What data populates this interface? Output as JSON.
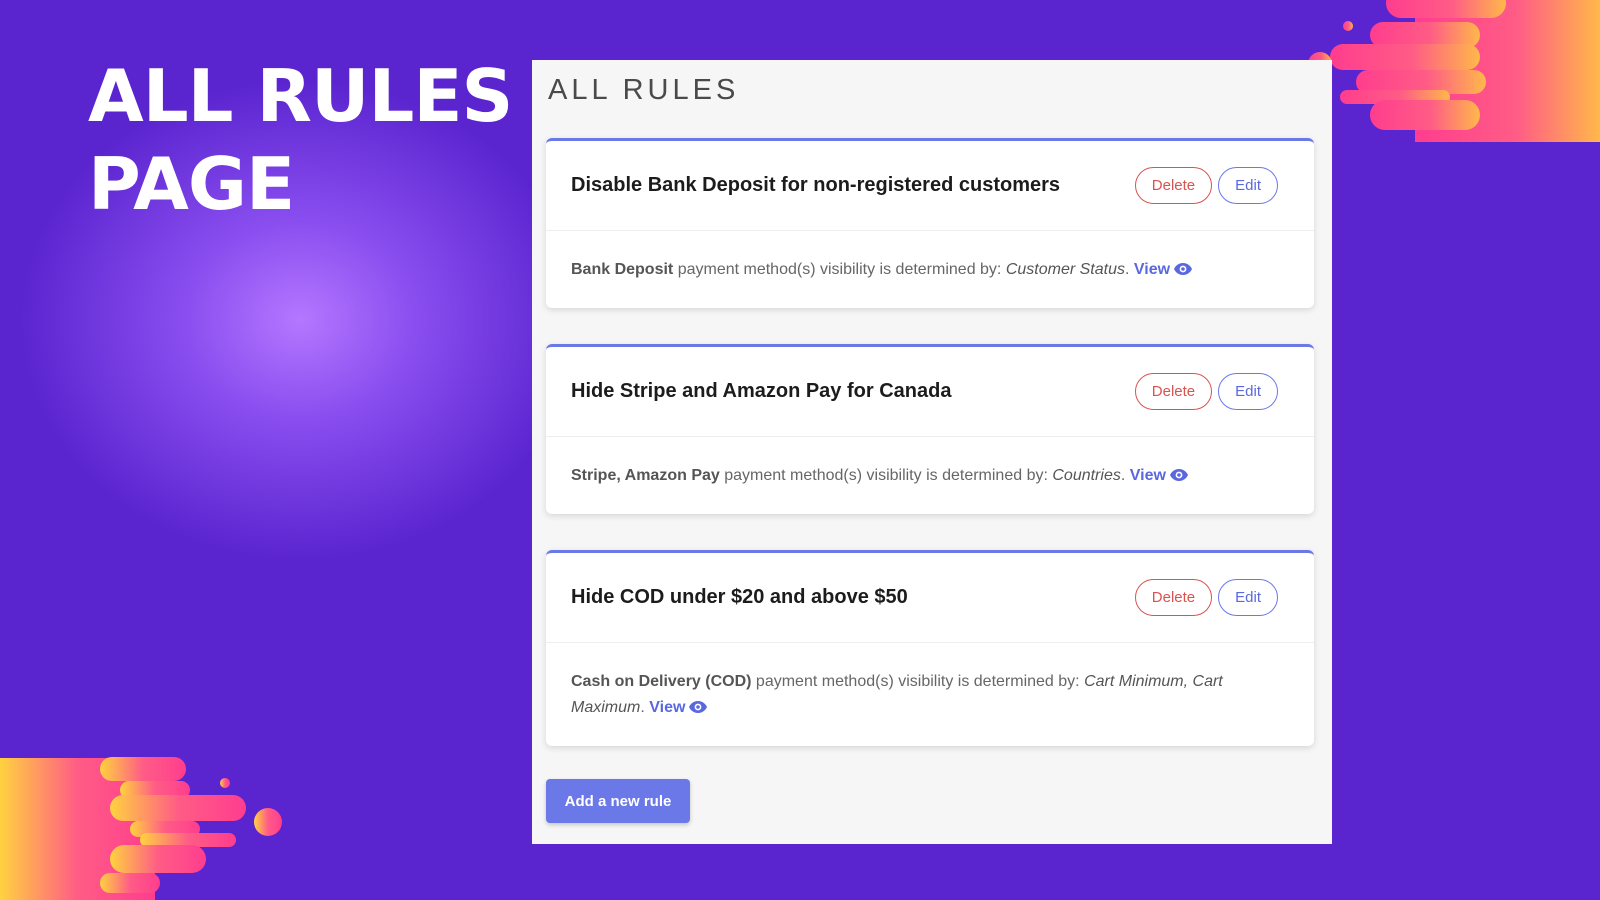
{
  "hero": {
    "title_line1": "ALL RULES",
    "title_line2": "PAGE"
  },
  "panel": {
    "title": "ALL RULES"
  },
  "rules": [
    {
      "title": "Disable Bank Deposit for non-registered customers",
      "methods": "Bank Deposit",
      "description": " payment method(s) visibility is determined by: ",
      "criteria": "Customer Status",
      "punctuation": ". ",
      "view_label": "View",
      "delete_label": "Delete",
      "edit_label": "Edit"
    },
    {
      "title": "Hide Stripe and Amazon Pay for Canada",
      "methods": "Stripe, Amazon Pay",
      "description": " payment method(s) visibility is determined by: ",
      "criteria": "Countries",
      "punctuation": ". ",
      "view_label": "View",
      "delete_label": "Delete",
      "edit_label": "Edit"
    },
    {
      "title": "Hide COD under $20 and above $50",
      "methods": "Cash on Delivery (COD)",
      "description": " payment method(s) visibility is determined by: ",
      "criteria": "Cart Minimum, Cart Maximum",
      "punctuation": ". ",
      "view_label": "View",
      "delete_label": "Delete",
      "edit_label": "Edit"
    }
  ],
  "add_rule_label": "Add a new rule",
  "colors": {
    "background": "#5a24cf",
    "accent": "#6b78e8",
    "delete": "#d9534f",
    "decoration_pink": "#ff3d8e",
    "decoration_orange": "#ffb84a"
  },
  "icons": {
    "view": "eye-icon"
  }
}
